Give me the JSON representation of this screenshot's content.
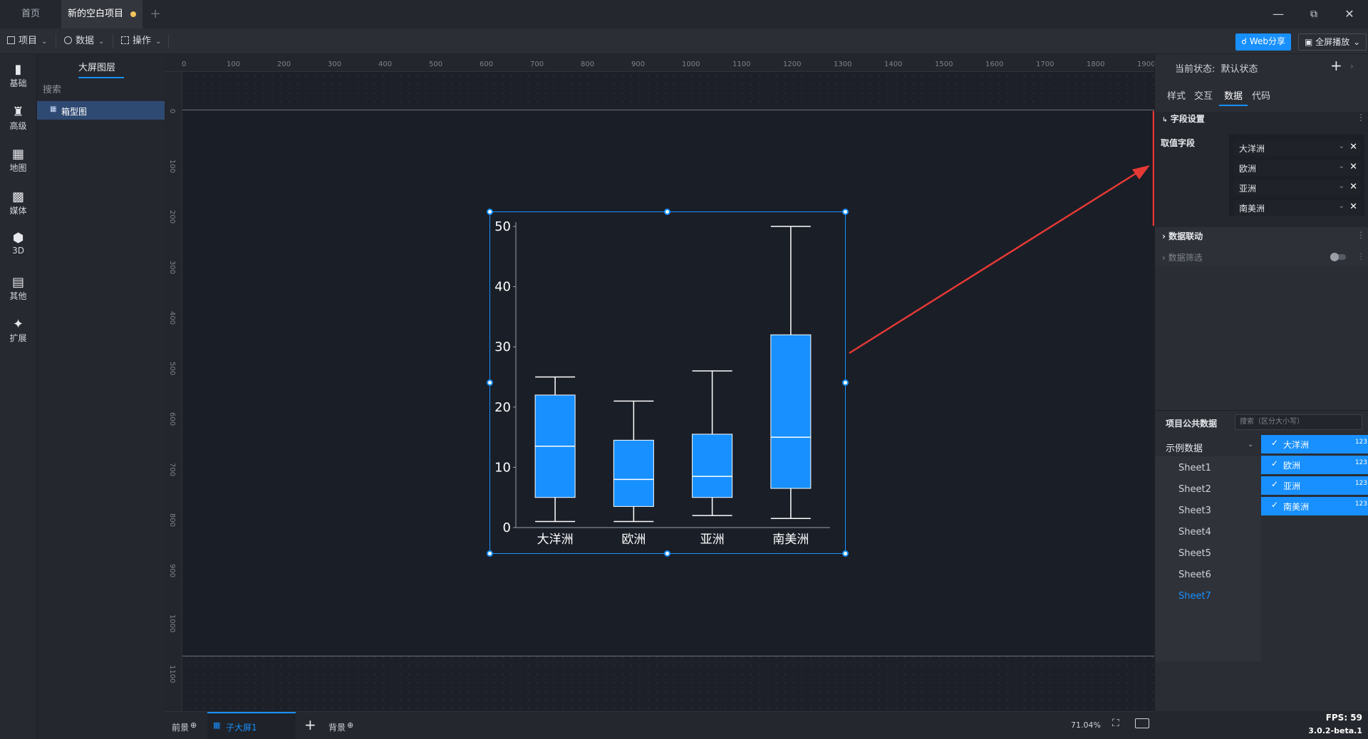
{
  "titlebar": {
    "tabs": [
      {
        "label": "首页"
      },
      {
        "label": "新的空白项目"
      }
    ],
    "add_tab_icon": "+",
    "window_controls": [
      "minimize-icon",
      "restore-icon",
      "close-icon"
    ]
  },
  "toolbar": {
    "menus": [
      {
        "label": "项目",
        "icon": "file-icon"
      },
      {
        "label": "数据",
        "icon": "database-icon"
      },
      {
        "label": "操作",
        "icon": "grid-icon"
      }
    ],
    "web_share_label": "Web分享",
    "fullscreen_label": "全屏播放"
  },
  "leftbar": {
    "items": [
      {
        "label": "基础",
        "icon": "bar-chart-icon"
      },
      {
        "label": "高级",
        "icon": "crown-icon"
      },
      {
        "label": "地图",
        "icon": "map-icon"
      },
      {
        "label": "媒体",
        "icon": "media-icon"
      },
      {
        "label": "3D",
        "icon": "cube-icon"
      },
      {
        "label": "其他",
        "icon": "list-icon"
      },
      {
        "label": "扩展",
        "icon": "puzzle-icon"
      }
    ]
  },
  "layers": {
    "title": "大屏图层",
    "search_placeholder": "搜索",
    "items": [
      {
        "label": "箱型图"
      }
    ]
  },
  "rulers": {
    "top": [
      "0",
      "100",
      "200",
      "300",
      "400",
      "500",
      "600",
      "700",
      "800",
      "900",
      "1000",
      "1100",
      "1200",
      "1300",
      "1400",
      "1500",
      "1600",
      "1700",
      "1800",
      "1900"
    ],
    "left": [
      "0",
      "100",
      "200",
      "300",
      "400",
      "500",
      "600",
      "700",
      "800",
      "900",
      "1000",
      "1100"
    ]
  },
  "chart_data": {
    "type": "box",
    "categories": [
      "大洋洲",
      "欧洲",
      "亚洲",
      "南美洲"
    ],
    "boxes": [
      {
        "category": "大洋洲",
        "min": 1,
        "q1": 5,
        "median": 13.5,
        "q3": 22,
        "max": 25
      },
      {
        "category": "欧洲",
        "min": 1,
        "q1": 3.5,
        "median": 8,
        "q3": 14.5,
        "max": 21
      },
      {
        "category": "亚洲",
        "min": 2,
        "q1": 5,
        "median": 8.5,
        "q3": 15.5,
        "max": 26
      },
      {
        "category": "南美洲",
        "min": 1.5,
        "q1": 6.5,
        "median": 15,
        "q3": 32,
        "max": 50
      }
    ],
    "ylim": [
      0,
      50
    ],
    "yticks": [
      "0",
      "10",
      "20",
      "30",
      "40",
      "50"
    ],
    "box_color": "#1890ff",
    "title": "",
    "xlabel": "",
    "ylabel": ""
  },
  "right_panel": {
    "state_label": "当前状态:",
    "state_value": "默认状态",
    "tabs": [
      "样式",
      "交互",
      "数据",
      "代码"
    ],
    "active_tab": "数据",
    "field_settings": {
      "title": "字段设置",
      "value_field_label": "取值字段",
      "fields": [
        "大洋洲",
        "欧洲",
        "亚洲",
        "南美洲"
      ]
    },
    "data_linkage_label": "数据联动",
    "data_filter_label": "数据筛选",
    "public_data": {
      "title": "项目公共数据",
      "search_placeholder": "搜索（区分大小写）",
      "dataset_label": "示例数据",
      "sheets": [
        "Sheet1",
        "Sheet2",
        "Sheet3",
        "Sheet4",
        "Sheet5",
        "Sheet6",
        "Sheet7"
      ],
      "active_sheet": "Sheet7",
      "columns": [
        {
          "label": "大洋洲",
          "type": "123"
        },
        {
          "label": "欧洲",
          "type": "123"
        },
        {
          "label": "亚洲",
          "type": "123"
        },
        {
          "label": "南美洲",
          "type": "123"
        }
      ]
    }
  },
  "bottombar": {
    "foreground_label": "前景",
    "sub_screen_label": "子大屏1",
    "background_label": "背景",
    "zoom": "71.04%"
  },
  "status": {
    "fps": "FPS: 59",
    "version": "3.0.2-beta.1"
  },
  "accent": "#1890ff",
  "annotation_color": "#e53935"
}
